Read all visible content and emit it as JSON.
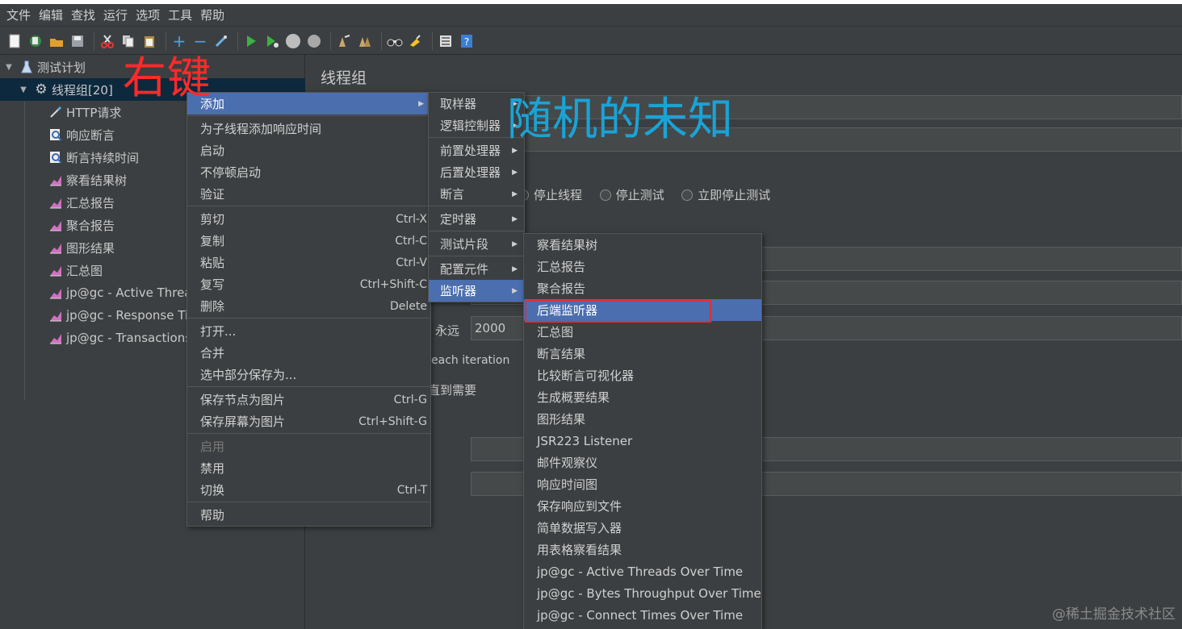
{
  "menubar": [
    "文件",
    "编辑",
    "查找",
    "运行",
    "选项",
    "工具",
    "帮助"
  ],
  "toolbar_icons": [
    "new-icon",
    "templates-icon",
    "open-icon",
    "save-icon",
    "sep",
    "cut-icon",
    "copy-icon",
    "paste-icon",
    "sep",
    "expand-icon",
    "collapse-icon",
    "toggle-icon",
    "sep",
    "start-icon",
    "start-no-pause-icon",
    "stop-icon",
    "shutdown-icon",
    "sep",
    "clear-icon",
    "clear-all-icon",
    "sep",
    "search-icon",
    "reset-search-icon",
    "sep",
    "function-helper-icon",
    "help-icon"
  ],
  "tree": [
    {
      "label": "测试计划",
      "icon": "flask-icon",
      "level": 0,
      "expanded": true
    },
    {
      "label": "线程组[20]",
      "icon": "gear-icon",
      "level": 1,
      "expanded": true,
      "selected": true
    },
    {
      "label": "HTTP请求",
      "icon": "pipette-icon",
      "level": 2
    },
    {
      "label": "响应断言",
      "icon": "magnifier-icon",
      "level": 2
    },
    {
      "label": "断言持续时间",
      "icon": "magnifier-icon",
      "level": 2
    },
    {
      "label": "察看结果树",
      "icon": "chart-icon",
      "level": 2
    },
    {
      "label": "汇总报告",
      "icon": "chart-icon",
      "level": 2
    },
    {
      "label": "聚合报告",
      "icon": "chart-icon",
      "level": 2
    },
    {
      "label": "图形结果",
      "icon": "chart-icon",
      "level": 2
    },
    {
      "label": "汇总图",
      "icon": "chart-icon",
      "level": 2
    },
    {
      "label": "jp@gc - Active Threads Over Time",
      "icon": "chart-icon",
      "level": 2
    },
    {
      "label": "jp@gc - Response Times Over Time",
      "icon": "chart-icon",
      "level": 2
    },
    {
      "label": "jp@gc - Transactions per Second",
      "icon": "chart-icon",
      "level": 2
    }
  ],
  "right_panel": {
    "title": "线程组",
    "stop_thread": "停止线程",
    "stop_test": "停止测试",
    "stop_test_now": "立即停止测试",
    "forever_label": "永远",
    "loop_value": "2000",
    "each_iteration": "each iteration",
    "until_needed": "直到需要"
  },
  "context_menu": [
    {
      "label": "添加",
      "submenu": true,
      "highlight": true
    },
    {
      "divider": true
    },
    {
      "label": "为子线程添加响应时间"
    },
    {
      "label": "启动"
    },
    {
      "label": "不停顿启动"
    },
    {
      "label": "验证"
    },
    {
      "divider": true
    },
    {
      "label": "剪切",
      "shortcut": "Ctrl-X"
    },
    {
      "label": "复制",
      "shortcut": "Ctrl-C"
    },
    {
      "label": "粘贴",
      "shortcut": "Ctrl-V"
    },
    {
      "label": "复写",
      "shortcut": "Ctrl+Shift-C"
    },
    {
      "label": "删除",
      "shortcut": "Delete"
    },
    {
      "divider": true
    },
    {
      "label": "打开..."
    },
    {
      "label": "合并"
    },
    {
      "label": "选中部分保存为..."
    },
    {
      "divider": true
    },
    {
      "label": "保存节点为图片",
      "shortcut": "Ctrl-G"
    },
    {
      "label": "保存屏幕为图片",
      "shortcut": "Ctrl+Shift-G"
    },
    {
      "divider": true
    },
    {
      "label": "启用",
      "disabled": true
    },
    {
      "label": "禁用"
    },
    {
      "label": "切换",
      "shortcut": "Ctrl-T"
    },
    {
      "divider": true
    },
    {
      "label": "帮助"
    }
  ],
  "add_submenu": [
    {
      "label": "取样器",
      "submenu": true
    },
    {
      "label": "逻辑控制器",
      "submenu": true
    },
    {
      "divider": true
    },
    {
      "label": "前置处理器",
      "submenu": true
    },
    {
      "label": "后置处理器",
      "submenu": true
    },
    {
      "label": "断言",
      "submenu": true
    },
    {
      "divider": true
    },
    {
      "label": "定时器",
      "submenu": true
    },
    {
      "divider": true
    },
    {
      "label": "测试片段",
      "submenu": true
    },
    {
      "divider": true
    },
    {
      "label": "配置元件",
      "submenu": true
    },
    {
      "label": "监听器",
      "submenu": true,
      "highlight": true
    }
  ],
  "listener_submenu": [
    {
      "label": "察看结果树"
    },
    {
      "label": "汇总报告"
    },
    {
      "label": "聚合报告"
    },
    {
      "label": "后端监听器",
      "highlight": true
    },
    {
      "label": "汇总图"
    },
    {
      "label": "断言结果"
    },
    {
      "label": "比较断言可视化器"
    },
    {
      "label": "生成概要结果"
    },
    {
      "label": "图形结果"
    },
    {
      "label": "JSR223 Listener"
    },
    {
      "label": "邮件观察仪"
    },
    {
      "label": "响应时间图"
    },
    {
      "label": "保存响应到文件"
    },
    {
      "label": "简单数据写入器"
    },
    {
      "label": "用表格察看结果"
    },
    {
      "label": "jp@gc - Active Threads Over Time"
    },
    {
      "label": "jp@gc - Bytes Throughput Over Time"
    },
    {
      "label": "jp@gc - Connect Times Over Time"
    }
  ],
  "annotations": {
    "right_click": "右键",
    "author": "随机的未知",
    "watermark": "@稀土掘金技术社区"
  },
  "colors": {
    "background": "#3c3f41",
    "highlight": "#4b6eaf",
    "selected_row": "#0d293e",
    "annotation_red": "#ff2a2a",
    "annotation_blue": "#1aa3d6",
    "red_box": "#d9323a"
  }
}
